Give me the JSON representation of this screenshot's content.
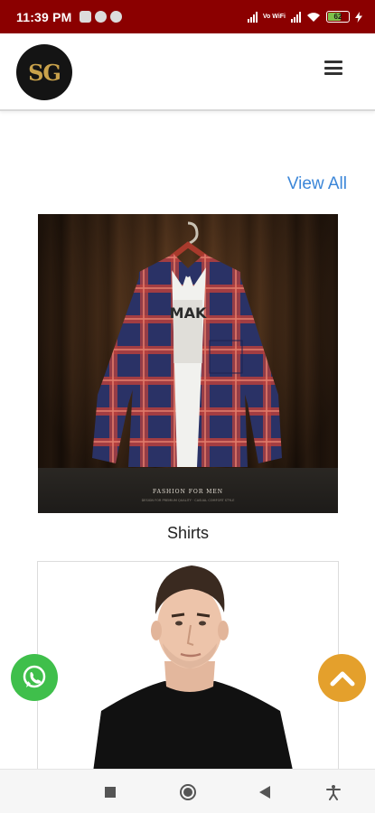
{
  "status_bar": {
    "time": "11:39 PM",
    "network_label": "Vo WiFi",
    "battery_level": "62"
  },
  "header": {
    "logo_text": "SG"
  },
  "section": {
    "view_all_label": "View All"
  },
  "categories": [
    {
      "label": "Shirts",
      "image_caption": "FASHION FOR MEN",
      "image_subcaption": "DESIGN FOR PREMIUM QUALITY · CASUAL COMFORT STYLE"
    },
    {
      "label": ""
    }
  ],
  "colors": {
    "status_bar_bg": "#8b0000",
    "link": "#3b86d8",
    "whatsapp_green": "#3fbf4b",
    "scroll_top_orange": "#e4a02c"
  },
  "icons": {
    "menu": "hamburger-icon",
    "whatsapp": "whatsapp-icon",
    "scroll_top": "chevron-up-icon",
    "nav_recents": "square-icon",
    "nav_home": "circle-icon",
    "nav_back": "triangle-back-icon",
    "nav_accessibility": "accessibility-icon"
  }
}
